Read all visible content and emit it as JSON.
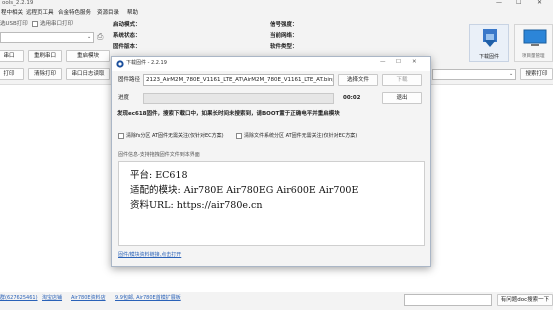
{
  "app": {
    "title": "ools_2.2.19",
    "window_controls": {
      "minimize": "—",
      "maximize": "☐",
      "close": "✕"
    }
  },
  "menu": [
    "程中相关",
    "远程页工具",
    "合金特色服务",
    "资源目录",
    "帮助"
  ],
  "left_panel": {
    "usb_label": "选USB打印",
    "check_label": "选用串口打印",
    "buttons_row1": [
      "串口",
      "重刷串口",
      "重启模块"
    ],
    "buttons_row2": [
      "打印",
      "清除打印",
      "串口日志读取"
    ]
  },
  "info": {
    "lines_left": [
      "启动模式：",
      "系统状态：",
      "固件版本："
    ],
    "lines_right": [
      "信号强度：",
      "当前网络：",
      "软件类型："
    ]
  },
  "right_panel": {
    "download_label": "下载固件",
    "other_label": "项目量管理",
    "search_button": "搜索打印"
  },
  "dialog": {
    "title": "下载固件 - 2.2.19",
    "path_label": "固件路径",
    "path_value": "2123_AirM2M_780E_V1161_LTE_AT\\AirM2M_780E_V1161_LTE_AT.binpkg",
    "select_button": "选择文件",
    "download_button": "下载",
    "progress_label": "进度",
    "progress_time": "00:02",
    "exit_button": "退出",
    "warning": "发现ec618固件，搜索下载口中，如果长时间未搜索到，请BOOT置于正确电平并重启模块",
    "checkbox1": "清除fs分区 AT固件无需关注(仅针对EC方案)",
    "checkbox2": "清除文件系统分区 AT固件无需关注(仅针对EC方案)",
    "info_label": "固件信息-支持拖拽固件文件到本界面",
    "info_lines": [
      "平台: EC618",
      "适配的模块: Air780E Air780EG Air600E Air700E",
      "资料URL: https://air780e.cn"
    ],
    "bottom_link": "固件/模块资料链接,点击打开"
  },
  "status_bar": {
    "links": [
      "群(627625461)",
      "淘宝店铺",
      "Air780E资料店",
      "9.9包邮, Air780E首模扩展板"
    ],
    "help_button": "有问题doc搜索一下"
  },
  "colors": {
    "link": "#2a62b8",
    "dialog_border": "#aab6c6",
    "info_text": "#111111"
  }
}
